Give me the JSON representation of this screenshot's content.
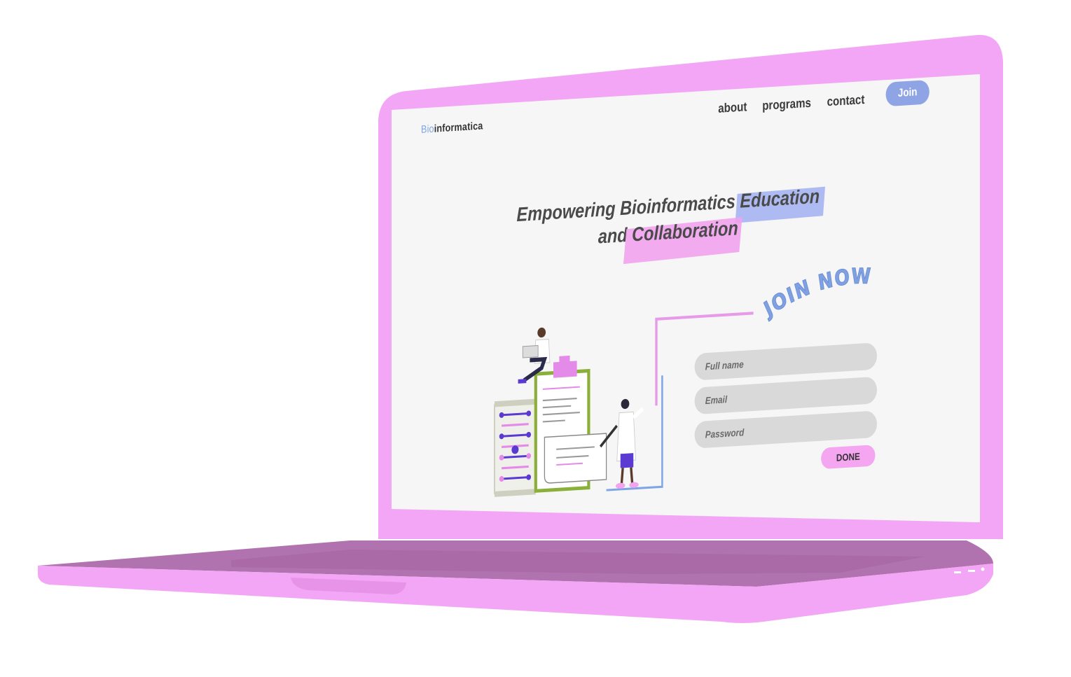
{
  "brand": {
    "prefix": "Bio",
    "suffix": "informatica"
  },
  "nav": {
    "items": [
      {
        "label": "about"
      },
      {
        "label": "programs"
      },
      {
        "label": "contact"
      }
    ],
    "join_label": "Join"
  },
  "hero": {
    "line1_plain": "Empowering Bioinformatics ",
    "line1_highlight": "Education",
    "line2_plain": "and ",
    "line2_highlight": "Collaboration"
  },
  "join_now": "JOIN NOW",
  "form": {
    "full_name_placeholder": "Full name",
    "email_placeholder": "Email",
    "password_placeholder": "Password",
    "submit_label": "DONE"
  },
  "colors": {
    "laptop_body": "#f3a6f5",
    "laptop_base_dark": "#b172ad",
    "screen_bg": "#f6f6f6",
    "accent_blue": "#8ea4e4",
    "accent_pink": "#f5a6f1",
    "join_now_blue": "#7fa1e2"
  },
  "icons": {
    "illustration": "scientists-dna-documents-illustration"
  }
}
